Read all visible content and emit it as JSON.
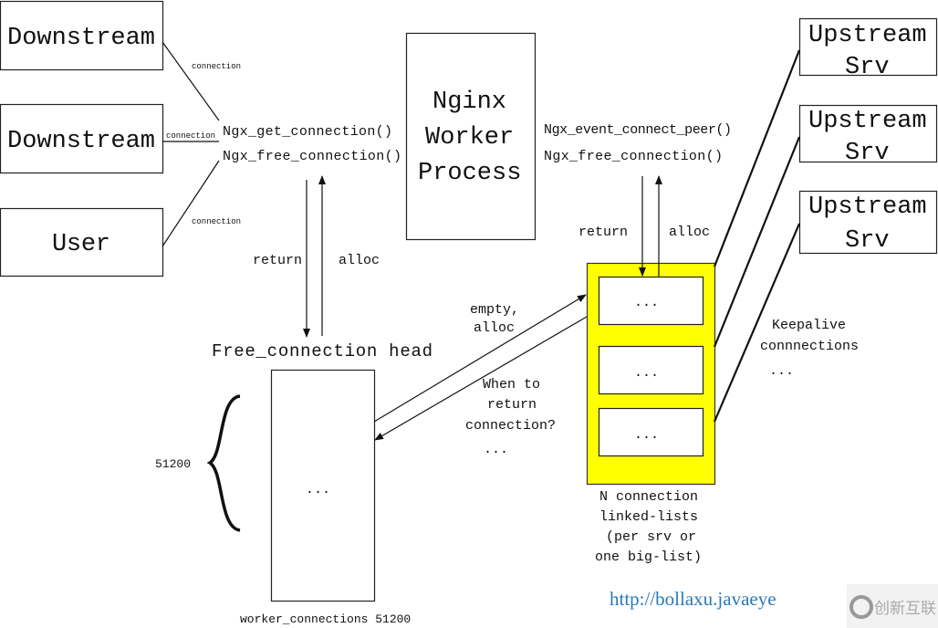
{
  "clients": [
    {
      "label": "Downstream",
      "link_label": "connection"
    },
    {
      "label": "Downstream",
      "link_label": "connection"
    },
    {
      "label": "User",
      "link_label": "connection"
    }
  ],
  "worker": {
    "line1": "Nginx",
    "line2": "Worker",
    "line3": "Process"
  },
  "left_api": {
    "get": "Ngx_get_connection()",
    "free": "Ngx_free_connection()",
    "return_label": "return",
    "alloc_label": "alloc"
  },
  "right_api": {
    "connect": "Ngx_event_connect_peer()",
    "free": "Ngx_free_connection()",
    "return_label": "return",
    "alloc_label": "alloc"
  },
  "free_list": {
    "head_label": "Free_connection head",
    "ellipsis": "...",
    "count": "51200",
    "footer": "worker_connections 51200"
  },
  "exchange": {
    "empty_line1": "empty,",
    "empty_line2": "alloc",
    "when_line1": "When to",
    "when_line2": "return",
    "when_line3": "connection?",
    "ellipsis": "..."
  },
  "pool": {
    "color": "#ffff00",
    "items": [
      "...",
      "...",
      "..."
    ],
    "caption": [
      "N connection",
      "linked-lists",
      "(per srv or",
      "one big-list)"
    ]
  },
  "upstreams": [
    {
      "line1": "Upstream",
      "line2": "Srv"
    },
    {
      "line1": "Upstream",
      "line2": "Srv"
    },
    {
      "line1": "Upstream",
      "line2": "Srv"
    }
  ],
  "keepalive": {
    "line1": "Keepalive",
    "line2": "connnections",
    "line3": "..."
  },
  "url": "http://bollaxu.javaeye",
  "watermark": "创新互联"
}
